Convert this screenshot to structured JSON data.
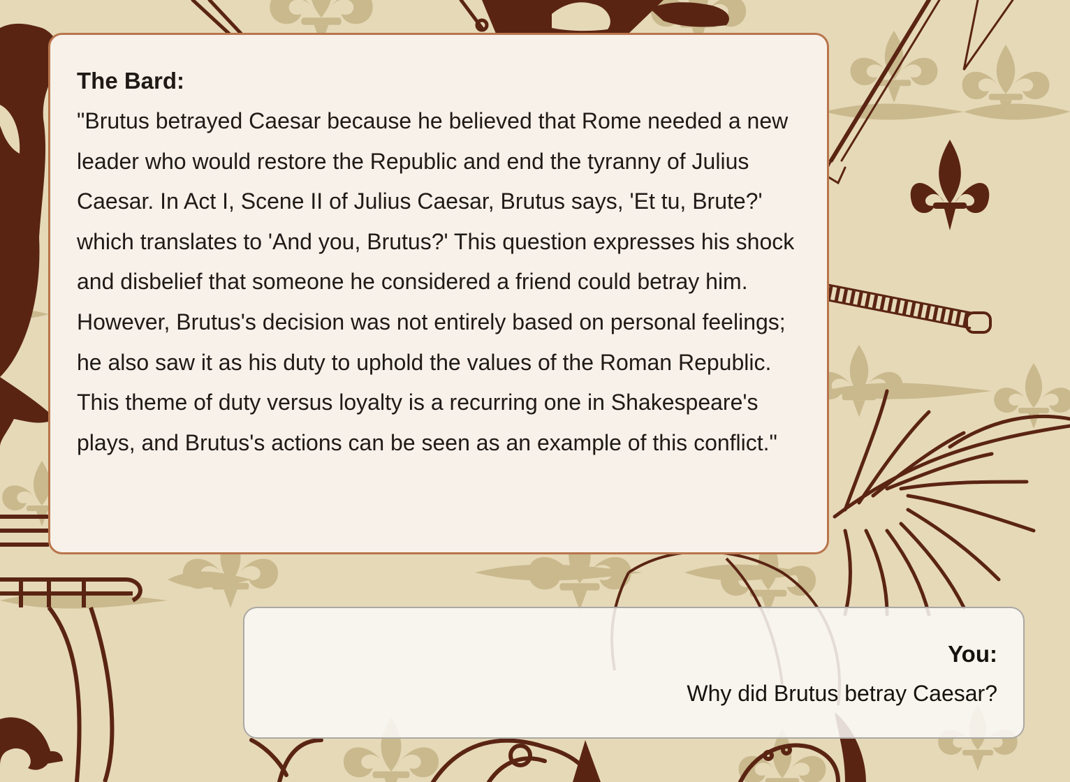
{
  "theme": {
    "background": "#e6d9b8",
    "motif_light": "#c9b98d",
    "motif_dark": "#5a2413",
    "bard_bubble_bg": "#f8f1ea",
    "bard_bubble_border": "#b8754c",
    "user_bubble_bg": "#faf9f7",
    "user_bubble_border": "#aaa8a4"
  },
  "background_art": {
    "icons": [
      "fleur-de-lis-icon",
      "sword-icon",
      "feather-plume-icon",
      "lion-crest-icon",
      "knight-helmet-icon",
      "shield-icon"
    ]
  },
  "chat": {
    "bard": {
      "speaker": "The Bard:",
      "message": "\"Brutus betrayed Caesar because he believed that Rome needed a new leader who would restore the Republic and end the tyranny of Julius Caesar. In Act I, Scene II of Julius Caesar, Brutus says, 'Et tu, Brute?' which translates to 'And you, Brutus?' This question expresses his shock and disbelief that someone he considered a friend could betray him. However, Brutus's decision was not entirely based on personal feelings; he also saw it as his duty to uphold the values of the Roman Republic. This theme of duty versus loyalty is a recurring one in Shakespeare's plays, and Brutus's actions can be seen as an example of this conflict.\""
    },
    "user": {
      "speaker": "You:",
      "message": "Why did Brutus betray Caesar?"
    }
  }
}
